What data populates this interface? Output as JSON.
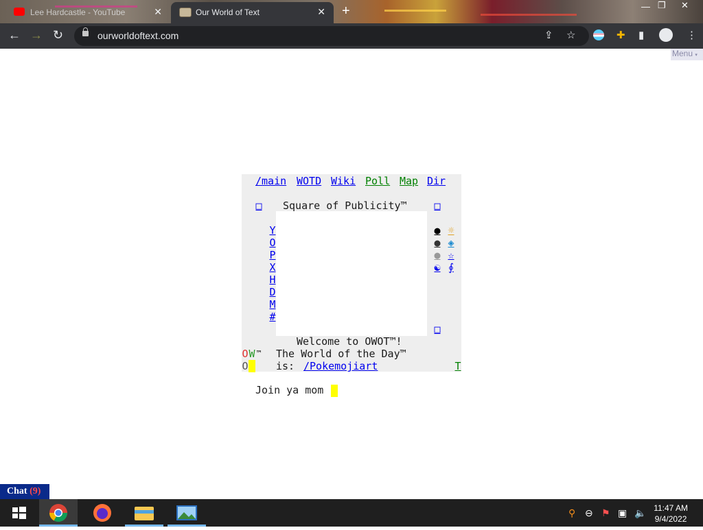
{
  "browser": {
    "tabs": [
      {
        "title": "Lee Hardcastle - YouTube",
        "active": false,
        "favicon": "youtube-icon"
      },
      {
        "title": "Our World of Text",
        "active": true,
        "favicon": "owot-icon"
      }
    ],
    "new_tab_label": "+",
    "address": "ourworldoftext.com",
    "accent": "#35363a"
  },
  "page": {
    "menu_label": "Menu",
    "menu_arrow": "▾",
    "nav_links": [
      "/main",
      "WOTD",
      "Wiki",
      "Poll",
      "Map",
      "Dir"
    ],
    "sop_title": "Square of Publicity™",
    "sop_box_char": "□",
    "left_links": [
      "Y",
      "O",
      "P",
      "X",
      "H",
      "D",
      "M",
      "#"
    ],
    "right_symbols": [
      "●",
      "☼",
      "●",
      "◈",
      "●",
      "☆",
      "☯",
      "∮"
    ],
    "welcome": "Welcome to OWOT™!",
    "wotd_line": "The World of the Day™",
    "wotd_is": "is:",
    "wotd_link": "/Pokemojiart",
    "left_marks": {
      "o_red": "O",
      "w_green": "W",
      "tm": "™",
      "o_gray": "O"
    },
    "right_mark": "T",
    "typed_text": "Join ya mom",
    "chat_label": "Chat",
    "chat_count": "(9)"
  },
  "taskbar": {
    "time": "11:47 AM",
    "date": "9/4/2022",
    "apps": [
      "windows-start-icon",
      "chrome-icon",
      "firefox-icon",
      "file-explorer-icon",
      "photos-icon"
    ]
  },
  "colors": {
    "link_blue": "#0000ee",
    "link_green": "#008000",
    "cursor_yellow": "#ffff00",
    "chat_bg": "#0a2a8a"
  }
}
